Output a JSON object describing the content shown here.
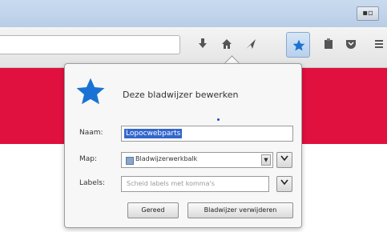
{
  "window": {
    "button_label": "▪▫"
  },
  "toolbar": {
    "icons": [
      "download-icon",
      "home-icon",
      "send-icon",
      "bookmark-star-icon",
      "clipboard-icon",
      "pocket-icon"
    ]
  },
  "panel": {
    "title": "Deze bladwijzer bewerken",
    "name_label": "Naam:",
    "name_value": "Lopocwebparts",
    "folder_label": "Map:",
    "folder_value": "Bladwijzerwerkbalk",
    "labels_label": "Labels:",
    "labels_placeholder": "Scheid labels met komma's",
    "done_button": "Gereed",
    "remove_button": "Bladwijzer verwijderen"
  },
  "colors": {
    "accent_star": "#1a73d4",
    "page_band": "#e0103f",
    "selection": "#3366cc"
  }
}
